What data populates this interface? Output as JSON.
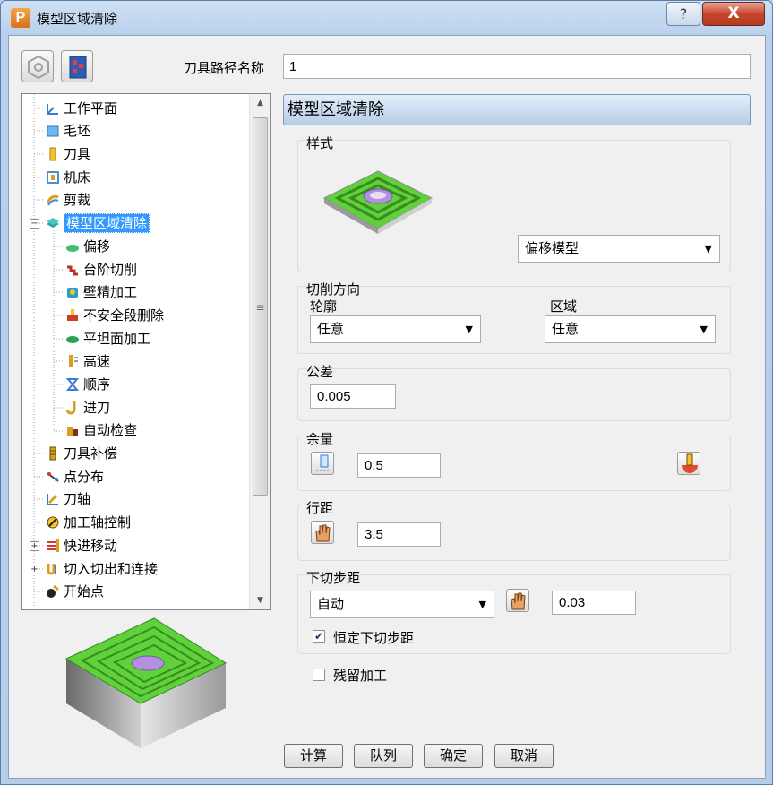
{
  "window": {
    "title": "模型区域清除",
    "app_icon": "P",
    "help": "?",
    "close": "X"
  },
  "toolpath_name": {
    "label": "刀具路径名称",
    "value": "1"
  },
  "tree": {
    "items": [
      {
        "label": "工作平面",
        "icon": "workplane-icon"
      },
      {
        "label": "毛坯",
        "icon": "block-icon"
      },
      {
        "label": "刀具",
        "icon": "tool-icon"
      },
      {
        "label": "机床",
        "icon": "machine-icon"
      },
      {
        "label": "剪裁",
        "icon": "limit-icon"
      },
      {
        "label": "模型区域清除",
        "icon": "area-clear-icon"
      },
      {
        "label": "偏移",
        "icon": "offset-icon"
      },
      {
        "label": "台阶切削",
        "icon": "step-cut-icon"
      },
      {
        "label": "壁精加工",
        "icon": "wall-finish-icon"
      },
      {
        "label": "不安全段删除",
        "icon": "unsafe-removal-icon"
      },
      {
        "label": "平坦面加工",
        "icon": "flat-machining-icon"
      },
      {
        "label": "高速",
        "icon": "high-speed-icon"
      },
      {
        "label": "顺序",
        "icon": "order-icon"
      },
      {
        "label": "进刀",
        "icon": "approach-icon"
      },
      {
        "label": "自动检查",
        "icon": "auto-verify-icon"
      },
      {
        "label": "刀具补偿",
        "icon": "tool-comp-icon"
      },
      {
        "label": "点分布",
        "icon": "point-dist-icon"
      },
      {
        "label": "刀轴",
        "icon": "tool-axis-icon"
      },
      {
        "label": "加工轴控制",
        "icon": "axis-control-icon"
      },
      {
        "label": "快进移动",
        "icon": "rapid-move-icon"
      },
      {
        "label": "切入切出和连接",
        "icon": "leads-links-icon"
      },
      {
        "label": "开始点",
        "icon": "start-point-icon"
      }
    ]
  },
  "panel": {
    "header": "模型区域清除",
    "style": {
      "title": "样式",
      "value": "偏移模型"
    },
    "cut_direction": {
      "title": "切削方向",
      "profile_label": "轮廓",
      "profile_value": "任意",
      "area_label": "区域",
      "area_value": "任意"
    },
    "tolerance": {
      "title": "公差",
      "value": "0.005"
    },
    "thickness": {
      "title": "余量",
      "value": "0.5"
    },
    "stepover": {
      "title": "行距",
      "value": "3.5"
    },
    "stepdown": {
      "title": "下切步距",
      "mode": "自动",
      "value": "0.03",
      "constant_label": "恒定下切步距",
      "constant_checked": true
    },
    "rest_label": "残留加工",
    "rest_checked": false
  },
  "buttons": {
    "calculate": "计算",
    "queue": "队列",
    "ok": "确定",
    "cancel": "取消"
  },
  "colors": {
    "accent": "#3399ff",
    "model_green": "#5fd13a",
    "model_purple": "#b48ee0"
  }
}
